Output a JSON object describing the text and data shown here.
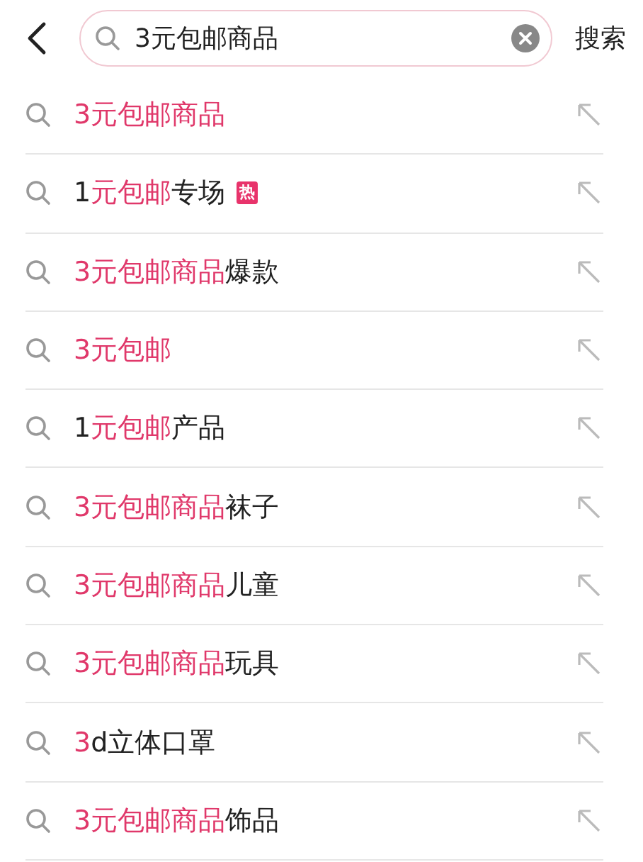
{
  "search": {
    "value": "3元包邮商品",
    "button": "搜索"
  },
  "suggestions": [
    {
      "segments": [
        {
          "text": "3元包邮商品",
          "highlight": true
        }
      ]
    },
    {
      "segments": [
        {
          "text": "1",
          "highlight": false
        },
        {
          "text": "元包邮",
          "highlight": true
        },
        {
          "text": "专场",
          "highlight": false
        }
      ],
      "badge": "热"
    },
    {
      "segments": [
        {
          "text": "3元包邮商品",
          "highlight": true
        },
        {
          "text": "爆款",
          "highlight": false
        }
      ]
    },
    {
      "segments": [
        {
          "text": "3元包邮",
          "highlight": true
        }
      ]
    },
    {
      "segments": [
        {
          "text": "1",
          "highlight": false
        },
        {
          "text": "元包邮",
          "highlight": true
        },
        {
          "text": "产品",
          "highlight": false
        }
      ]
    },
    {
      "segments": [
        {
          "text": "3元包邮商品",
          "highlight": true
        },
        {
          "text": "袜子",
          "highlight": false
        }
      ]
    },
    {
      "segments": [
        {
          "text": "3元包邮商品",
          "highlight": true
        },
        {
          "text": "儿童",
          "highlight": false
        }
      ]
    },
    {
      "segments": [
        {
          "text": "3元包邮商品",
          "highlight": true
        },
        {
          "text": "玩具",
          "highlight": false
        }
      ]
    },
    {
      "segments": [
        {
          "text": "3",
          "highlight": true
        },
        {
          "text": "d立体口罩",
          "highlight": false
        }
      ]
    },
    {
      "segments": [
        {
          "text": "3元包邮商品",
          "highlight": true
        },
        {
          "text": "饰品",
          "highlight": false
        }
      ]
    }
  ]
}
